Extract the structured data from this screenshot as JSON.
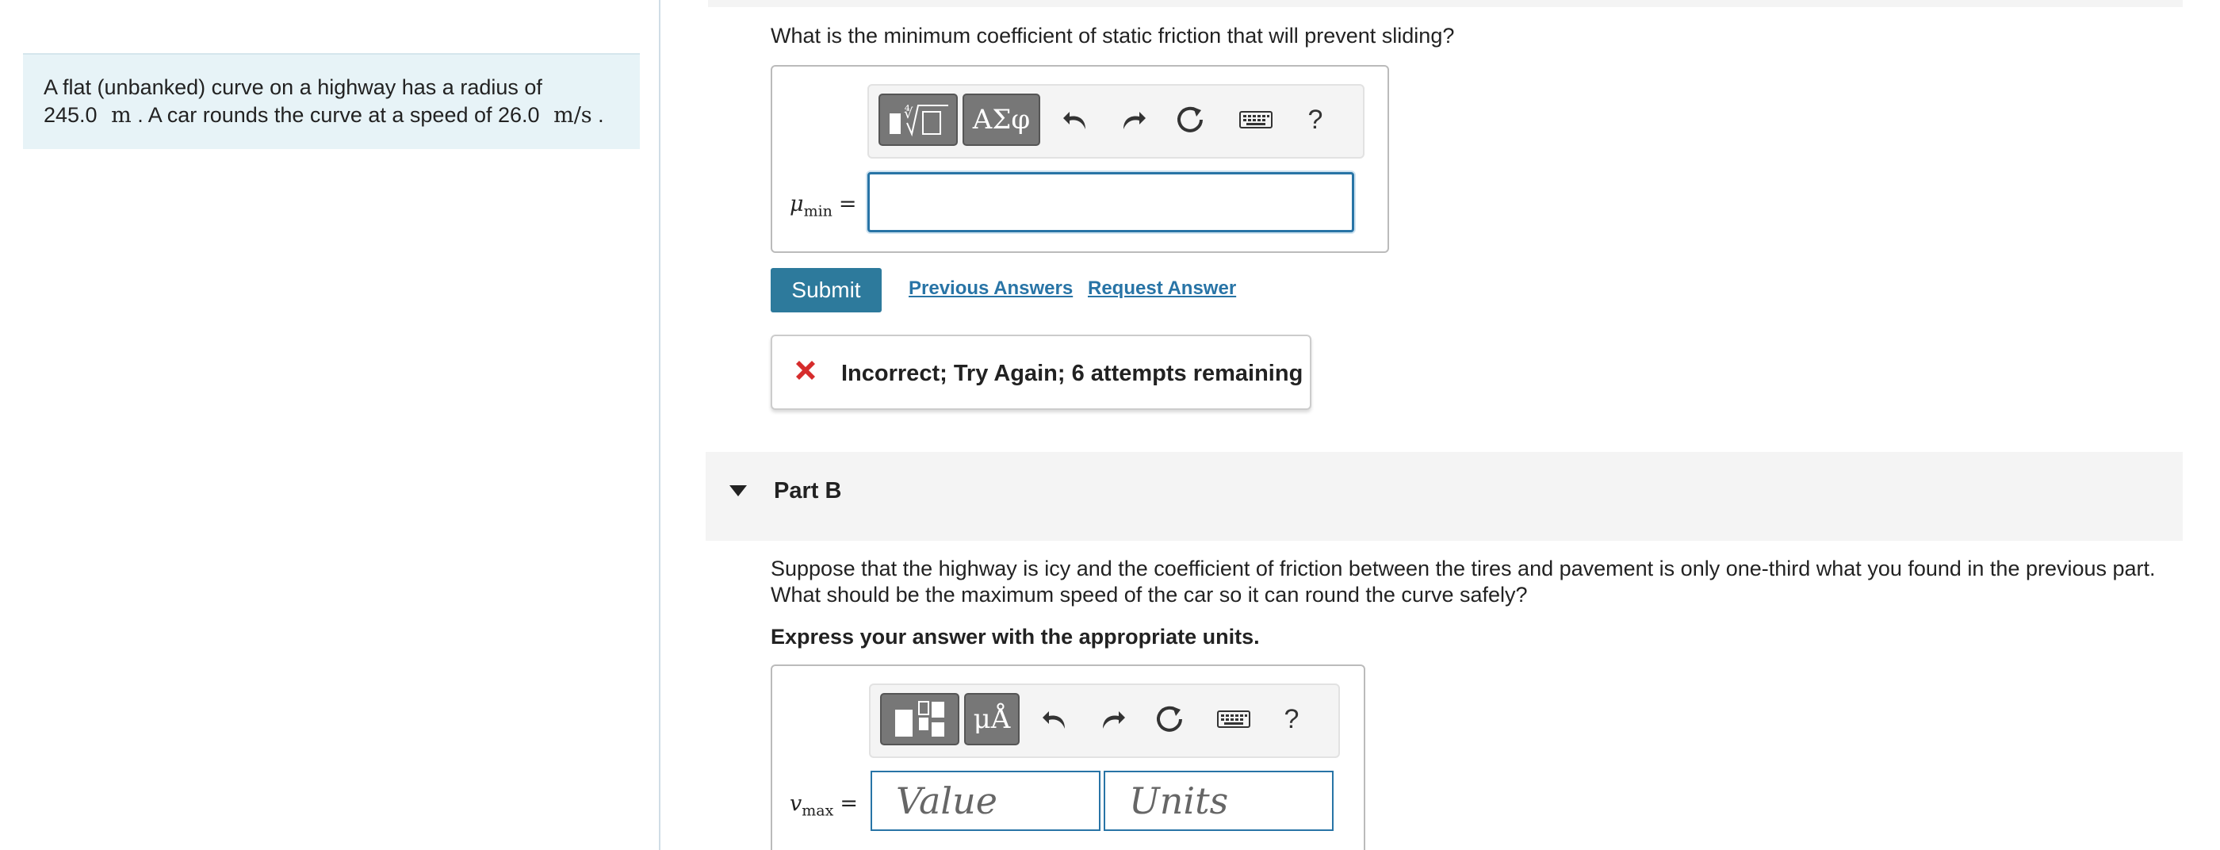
{
  "problem": {
    "line1": "A flat (unbanked) curve on a highway has a radius of",
    "radius_value": "245.0",
    "radius_unit": "m",
    "line2_mid": ". A car rounds the curve at a speed of",
    "speed_value": "26.0",
    "speed_unit": "m/s",
    "line2_end": "."
  },
  "part_a": {
    "question": "What is the minimum coefficient of static friction that will prevent sliding?",
    "toolbar": {
      "template_label": "",
      "greek_label": "ΑΣφ",
      "help_label": "?"
    },
    "variable": "μ",
    "variable_sub": "min",
    "equals": "=",
    "answer_value": "",
    "submit_label": "Submit",
    "previous_answers_label": "Previous Answers",
    "request_answer_label": "Request Answer",
    "feedback": "Incorrect; Try Again; 6 attempts remaining"
  },
  "part_b": {
    "title": "Part B",
    "question": "Suppose that the highway is icy and the coefficient of friction between the tires and pavement is only one-third what you found in the previous part. What should be the maximum speed of the car so it can round the curve safely?",
    "instruction": "Express your answer with the appropriate units.",
    "toolbar": {
      "units_label": "μÅ",
      "help_label": "?"
    },
    "variable": "v",
    "variable_sub": "max",
    "equals": "=",
    "value_placeholder": "Value",
    "units_placeholder": "Units"
  },
  "colors": {
    "accent": "#2874a6",
    "submit_bg": "#2d7a9c",
    "problem_bg": "#e7f3f7",
    "error_red": "#d62c2c"
  }
}
